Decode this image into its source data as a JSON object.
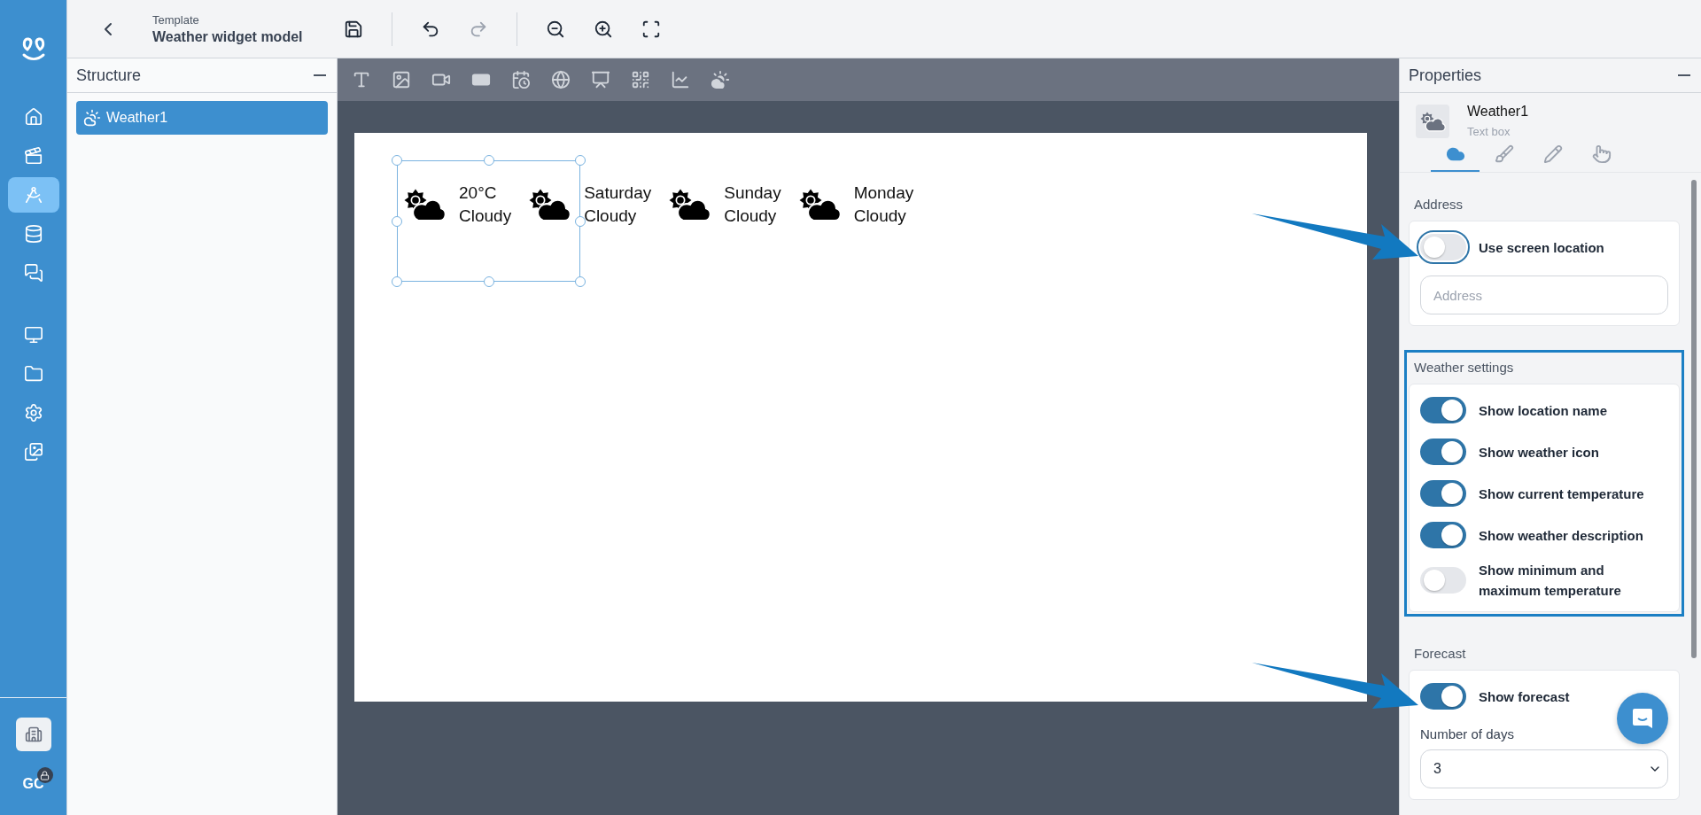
{
  "nav": {
    "groups": [
      [
        {
          "kind": "home",
          "selected": false
        },
        {
          "kind": "media",
          "selected": false
        },
        {
          "kind": "design",
          "selected": true
        },
        {
          "kind": "data",
          "selected": false
        },
        {
          "kind": "messages",
          "selected": false
        }
      ],
      [
        {
          "kind": "screens",
          "selected": false
        },
        {
          "kind": "files",
          "selected": false
        },
        {
          "kind": "settings",
          "selected": false
        },
        {
          "kind": "gallery",
          "selected": false
        }
      ]
    ],
    "user_initials": "GC"
  },
  "header": {
    "subtitle": "Template",
    "title": "Weather widget model",
    "tools": [
      {
        "kind": "save",
        "disabled": false
      },
      {
        "kind": "undo",
        "disabled": false
      },
      {
        "kind": "redo",
        "disabled": true
      },
      {
        "kind": "zoom_out",
        "disabled": false
      },
      {
        "kind": "zoom_in",
        "disabled": false
      },
      {
        "kind": "fit",
        "disabled": false
      }
    ]
  },
  "structure": {
    "title": "Structure",
    "items": [
      {
        "label": "Weather1",
        "selected": true
      }
    ]
  },
  "palette": [
    {
      "kind": "text"
    },
    {
      "kind": "image"
    },
    {
      "kind": "video"
    },
    {
      "kind": "shape"
    },
    {
      "kind": "calendar"
    },
    {
      "kind": "web"
    },
    {
      "kind": "presentation"
    },
    {
      "kind": "qr"
    },
    {
      "kind": "chart"
    },
    {
      "kind": "weather"
    }
  ],
  "widget": {
    "selected": true,
    "current": {
      "temperature": "20°C",
      "description": "Cloudy"
    },
    "forecast": [
      {
        "day": "Saturday",
        "description": "Cloudy"
      },
      {
        "day": "Sunday",
        "description": "Cloudy"
      },
      {
        "day": "Monday",
        "description": "Cloudy"
      }
    ]
  },
  "properties": {
    "title": "Properties",
    "element": {
      "name": "Weather1",
      "type": "Text box"
    },
    "tabs": [
      {
        "kind": "data",
        "selected": true
      },
      {
        "kind": "style",
        "selected": false
      },
      {
        "kind": "edit",
        "selected": false
      },
      {
        "kind": "action",
        "selected": false
      }
    ],
    "sections": [
      {
        "title": "Address",
        "highlighted": false,
        "arrow": true,
        "toggles": [
          {
            "label": "Use screen location",
            "on": false,
            "focused": true
          }
        ],
        "field": {
          "placeholder": "Address"
        }
      },
      {
        "title": "Weather settings",
        "highlighted": true,
        "arrow": false,
        "toggles": [
          {
            "label": "Show location name",
            "on": true,
            "focused": false
          },
          {
            "label": "Show weather icon",
            "on": true,
            "focused": false
          },
          {
            "label": "Show current temperature",
            "on": true,
            "focused": false
          },
          {
            "label": "Show weather description",
            "on": true,
            "focused": false
          },
          {
            "label": "Show minimum and maximum temperature",
            "on": false,
            "focused": false
          }
        ]
      },
      {
        "title": "Forecast",
        "highlighted": false,
        "arrow": true,
        "toggles": [
          {
            "label": "Show forecast",
            "on": true,
            "focused": false
          }
        ],
        "number": {
          "label": "Number of days",
          "value": "3"
        }
      }
    ]
  }
}
